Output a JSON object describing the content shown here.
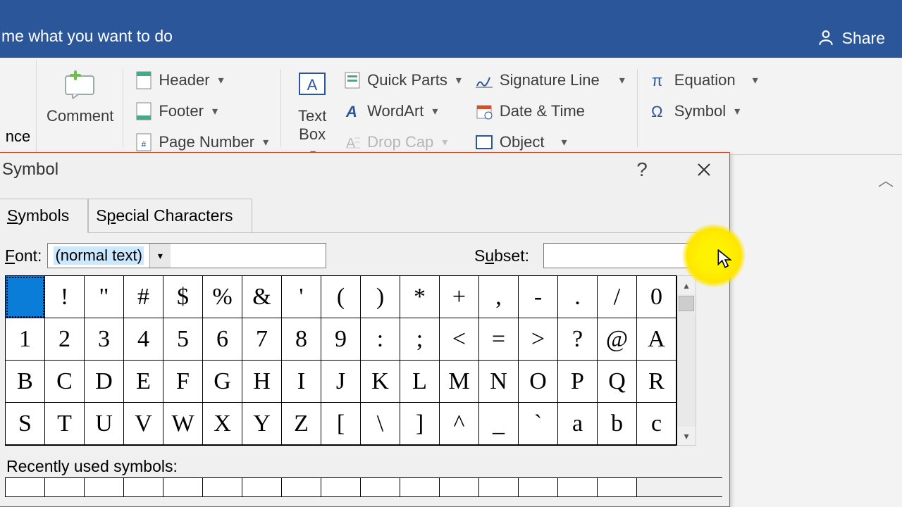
{
  "titlebar": {
    "tell_me": "me what you want to do",
    "share": "Share"
  },
  "ribbon": {
    "left_cut": "nce",
    "comment": "Comment",
    "header": "Header",
    "footer": "Footer",
    "page_number": "Page Number",
    "text_box": "Text\nBox",
    "quick_parts": "Quick Parts",
    "wordart": "WordArt",
    "drop_cap": "Drop Cap",
    "signature_line": "Signature Line",
    "date_time": "Date & Time",
    "object": "Object",
    "equation": "Equation",
    "symbol": "Symbol"
  },
  "dialog": {
    "title": "Symbol",
    "help": "?",
    "tabs": {
      "symbols": "Symbols",
      "special": "Special Characters"
    },
    "font_label": "Font:",
    "font_value": "(normal text)",
    "subset_label": "Subset:",
    "subset_value": "",
    "recent_label": "Recently used symbols:"
  },
  "chart_data": {
    "type": "table",
    "grid_columns": 17,
    "cells": [
      " ",
      "!",
      "\"",
      "#",
      "$",
      "%",
      "&",
      "'",
      "(",
      ")",
      "*",
      "+",
      ",",
      "-",
      ".",
      "/",
      "0",
      "1",
      "2",
      "3",
      "4",
      "5",
      "6",
      "7",
      "8",
      "9",
      ":",
      ";",
      "<",
      "=",
      ">",
      "?",
      "@",
      "A",
      "B",
      "C",
      "D",
      "E",
      "F",
      "G",
      "H",
      "I",
      "J",
      "K",
      "L",
      "M",
      "N",
      "O",
      "P",
      "Q",
      "R",
      "S",
      "T",
      "U",
      "V",
      "W",
      "X",
      "Y",
      "Z",
      "[",
      "\\",
      "]",
      "^",
      "_",
      "`",
      "a",
      "b",
      "c"
    ],
    "selected_index": 0,
    "recent": [
      "",
      "",
      "",
      "",
      "",
      "",
      "",
      "",
      "",
      "",
      "",
      "",
      "",
      "",
      "",
      ""
    ]
  }
}
